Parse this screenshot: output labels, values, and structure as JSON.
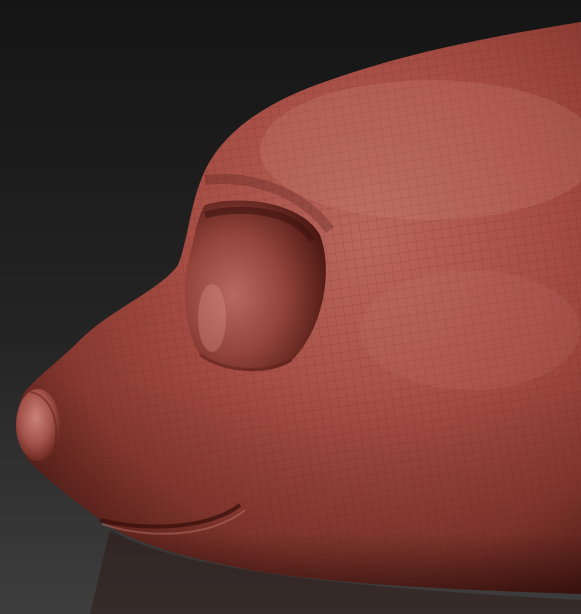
{
  "scene": {
    "subject": "sculpted-animal-head",
    "background": {
      "top": "#171717",
      "bottom": "#3c3c3c"
    },
    "material": {
      "base": "#a84a42",
      "shadow": "#4f1a15",
      "highlight": "#c97d72",
      "wire": "#5a1f18"
    }
  }
}
